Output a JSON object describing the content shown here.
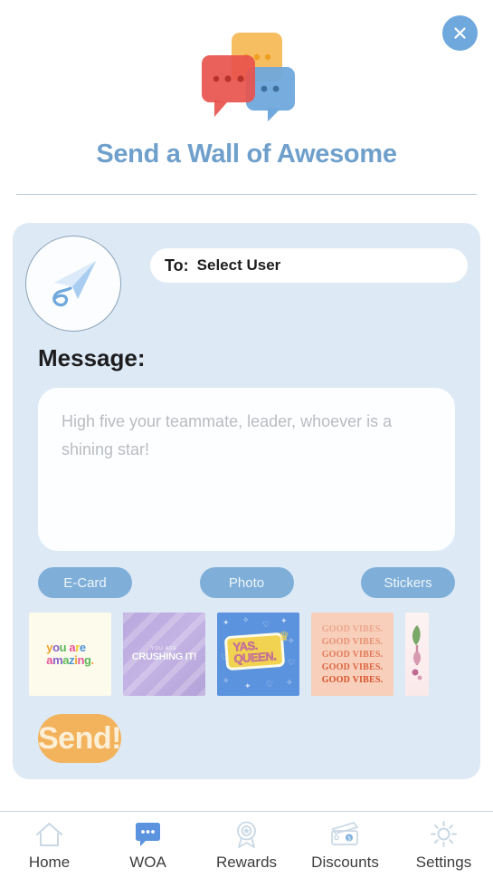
{
  "header": {
    "close_label": "close",
    "close_icon": "close-x-icon",
    "logo_icon": "three-chat-bubbles-icon",
    "title": "Send a Wall of Awesome",
    "title_color": "#6fa0cc",
    "logo_colors": {
      "orange": "#f6bd61",
      "red": "#e8524c",
      "blue": "#6fa8dc"
    }
  },
  "compose": {
    "avatar_icon": "paper-airplane-icon",
    "to_label": "To:",
    "to_value": "Select User",
    "message_label": "Message:",
    "message_value": "",
    "message_placeholder": "High five your teammate, leader, whoever is a shining star!"
  },
  "tabs": [
    {
      "label": "E-Card",
      "name": "tab-ecard"
    },
    {
      "label": "Photo",
      "name": "tab-photo"
    },
    {
      "label": "Stickers",
      "name": "tab-stickers"
    }
  ],
  "tab_color": "#7fafd8",
  "stickers": [
    {
      "name": "sticker-you-are-amazing",
      "type": "amazing",
      "lines": [
        "you are",
        "amazing."
      ],
      "bg": "#fdfbec",
      "letter_colors": [
        "#f0a02e",
        "#8a63c9",
        "#5bb85b",
        "#e8549b",
        "#f0c92e",
        "#4f93d6"
      ]
    },
    {
      "name": "sticker-crushing-it",
      "type": "crushing",
      "small_text": "YOU ARE",
      "big_text": "CRUSHING IT!",
      "bg": "#b9a8dd"
    },
    {
      "name": "sticker-yas-queen",
      "type": "queen",
      "line1": "YAS.",
      "line2": "QUEEN.",
      "bg": "#5b93de",
      "badge_bg": "#f2d351",
      "text_color": "#d17ba4",
      "crown_icon": "crown-icon"
    },
    {
      "name": "sticker-good-vibes",
      "type": "vibes",
      "repeat_text": "GOOD VIBES.",
      "repeat_count": 5,
      "bg": "#f7cfbb",
      "text_color": "#d9522b"
    },
    {
      "name": "sticker-plant-partial",
      "type": "plant",
      "bg": "#fdf3f3",
      "partial": true
    }
  ],
  "send": {
    "label": "Send!",
    "bg": "#f3b35c",
    "text_color": "#fcefd8"
  },
  "bottom_nav": {
    "active_index": 1,
    "active_color": "#5b93de",
    "inactive_color": "#c9d8e4",
    "items": [
      {
        "label": "Home",
        "icon": "home-icon",
        "name": "nav-home"
      },
      {
        "label": "WOA",
        "icon": "chat-bubble-icon",
        "name": "nav-woa"
      },
      {
        "label": "Rewards",
        "icon": "award-ribbon-icon",
        "name": "nav-rewards"
      },
      {
        "label": "Discounts",
        "icon": "wallet-cards-icon",
        "name": "nav-discounts"
      },
      {
        "label": "Settings",
        "icon": "gear-icon",
        "name": "nav-settings"
      }
    ]
  }
}
